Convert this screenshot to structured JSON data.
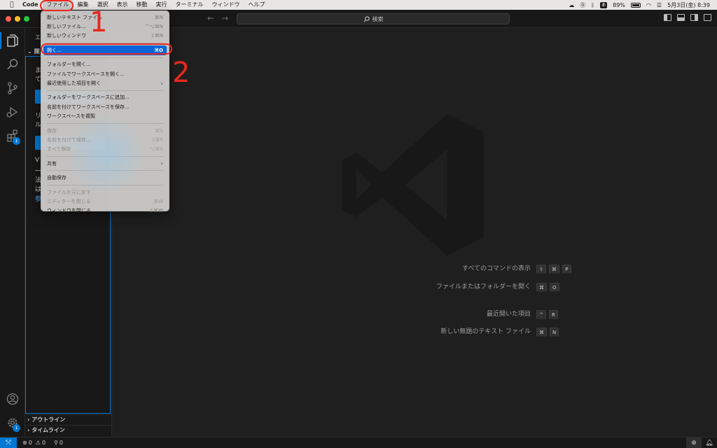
{
  "menubar": {
    "app": "Code",
    "items": [
      "ファイル",
      "編集",
      "選択",
      "表示",
      "移動",
      "実行",
      "ターミナル",
      "ウィンドウ",
      "ヘルプ"
    ],
    "ime": "あ",
    "battery": "89%",
    "datetime": "5月3日(金)  8:39"
  },
  "titlebar": {
    "search": "検索"
  },
  "activity": {
    "extensions_badge": "1",
    "accounts_badge": "1"
  },
  "sidebar": {
    "title": "エ",
    "section": "開",
    "lines": [
      "ま",
      "て",
      "リ",
      "ル",
      "V",
      "一",
      "法",
      "は"
    ],
    "link": "参",
    "outline": "アウトライン",
    "timeline": "タイムライン"
  },
  "file_menu": {
    "items": [
      {
        "label": "新しいテキスト ファイル",
        "shortcut": "⌘N",
        "disabled": false
      },
      {
        "label": "新しいファイル...",
        "shortcut": "^⌥⌘N",
        "disabled": false
      },
      {
        "label": "新しいウィンドウ",
        "shortcut": "⇧⌘N",
        "disabled": false
      },
      {
        "label": "開く...",
        "shortcut": "⌘O",
        "selected": true
      },
      {
        "label": "フォルダーを開く...",
        "shortcut": ""
      },
      {
        "label": "ファイルでワークスペースを開く...",
        "shortcut": ""
      },
      {
        "label": "最近使用した項目を開く",
        "shortcut": "",
        "submenu": true
      },
      {
        "label": "フォルダーをワークスペースに追加...",
        "shortcut": ""
      },
      {
        "label": "名前を付けてワークスペースを保存...",
        "shortcut": ""
      },
      {
        "label": "ワークスペースを複製",
        "shortcut": ""
      },
      {
        "label": "保存",
        "shortcut": "⌘S",
        "disabled": true
      },
      {
        "label": "名前を付けて保存...",
        "shortcut": "⇧⌘S",
        "disabled": true
      },
      {
        "label": "すべて保存",
        "shortcut": "⌥⌘S",
        "disabled": true
      },
      {
        "label": "共有",
        "shortcut": "",
        "submenu": true
      },
      {
        "label": "自動保存",
        "shortcut": ""
      },
      {
        "label": "ファイルを元に戻す",
        "shortcut": "",
        "disabled": true
      },
      {
        "label": "エディターを閉じる",
        "shortcut": "⌘W",
        "disabled": true
      },
      {
        "label": "ウィンドウを閉じる",
        "shortcut": "⇧⌘W",
        "disabled": false
      }
    ]
  },
  "welcome": {
    "shortcuts": [
      {
        "label": "すべてのコマンドの表示",
        "keys": [
          "⇧",
          "⌘",
          "P"
        ]
      },
      {
        "label": "ファイルまたはフォルダーを開く",
        "keys": [
          "⌘",
          "O"
        ]
      },
      {
        "label": "最近開いた項目",
        "keys": [
          "^",
          "R"
        ]
      },
      {
        "label": "新しい無題のテキスト ファイル",
        "keys": [
          "⌘",
          "N"
        ]
      }
    ]
  },
  "statusbar": {
    "errors": "0",
    "warnings": "0",
    "ports": "0"
  },
  "annotations": {
    "step1": "1",
    "step2": "2"
  },
  "colors": {
    "accent": "#0078d4",
    "annotation": "#e8281f",
    "menu_selected": "#0b64d8"
  }
}
